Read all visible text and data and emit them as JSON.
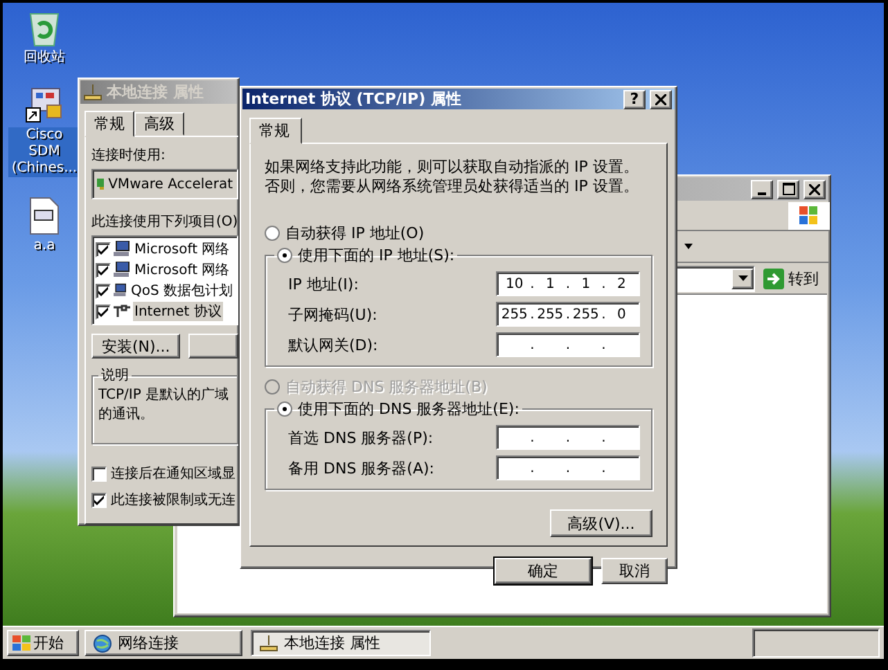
{
  "desktop_icons": [
    {
      "label": "回收站",
      "kind": "recycle"
    },
    {
      "label": "Cisco SDM (Chines...",
      "kind": "shortcut"
    },
    {
      "label": "a.a",
      "kind": "file"
    }
  ],
  "explorer_window": {
    "active": false,
    "go_button": "转到"
  },
  "connection_dialog": {
    "title": "本地连接 属性",
    "active": false,
    "tabs": [
      {
        "label": "常规",
        "selected": true
      },
      {
        "label": "高级",
        "selected": false
      }
    ],
    "connect_using_label": "连接时使用:",
    "adapter": "VMware Accelerat",
    "items_label": "此连接使用下列项目(O)",
    "items": [
      {
        "label": "Microsoft 网络",
        "checked": true,
        "selected": false,
        "kind": "client"
      },
      {
        "label": "Microsoft 网络",
        "checked": true,
        "selected": false,
        "kind": "client"
      },
      {
        "label": "QoS 数据包计划",
        "checked": true,
        "selected": false,
        "kind": "client"
      },
      {
        "label": "Internet 协议",
        "checked": true,
        "selected": true,
        "kind": "protocol"
      }
    ],
    "install_button": "安装(N)...",
    "description": {
      "legend": "说明",
      "lines": [
        "TCP/IP 是默认的广域",
        "的通讯。"
      ]
    },
    "options": [
      {
        "label": "连接后在通知区域显",
        "checked": false
      },
      {
        "label": "此连接被限制或无连",
        "checked": true
      }
    ]
  },
  "tcpip_dialog": {
    "title": "Internet 协议 (TCP/IP) 属性",
    "active": true,
    "help_button": "?",
    "tabs": [
      {
        "label": "常规",
        "selected": true
      }
    ],
    "intro": "如果网络支持此功能，则可以获取自动指派的 IP 设置。否则，您需要从网络系统管理员处获得适当的 IP 设置。",
    "ip_options": [
      {
        "label": "自动获得 IP 地址(O)",
        "selected": false,
        "disabled": false
      },
      {
        "label": "使用下面的 IP 地址(S):",
        "selected": true,
        "disabled": false
      }
    ],
    "ip_fields": [
      {
        "label": "IP 地址(I):",
        "octets": [
          "10",
          "1",
          "1",
          "2"
        ]
      },
      {
        "label": "子网掩码(U):",
        "octets": [
          "255",
          "255",
          "255",
          "0"
        ]
      },
      {
        "label": "默认网关(D):"
      }
    ],
    "dns_options": [
      {
        "label": "自动获得 DNS 服务器地址(B)",
        "selected": false,
        "disabled": true
      },
      {
        "label": "使用下面的 DNS 服务器地址(E):",
        "selected": true,
        "disabled": false
      }
    ],
    "dns_fields": [
      {
        "label": "首选 DNS 服务器(P):"
      },
      {
        "label": "备用 DNS 服务器(A):"
      }
    ],
    "separator": ".",
    "advanced_button": "高级(V)...",
    "ok_button": "确定",
    "cancel_button": "取消"
  },
  "taskbar": {
    "start_button": "开始",
    "tasks": [
      {
        "label": "网络连接",
        "selected": false,
        "kind": "network"
      },
      {
        "label": "本地连接 属性",
        "selected": true,
        "kind": "properties"
      }
    ]
  }
}
